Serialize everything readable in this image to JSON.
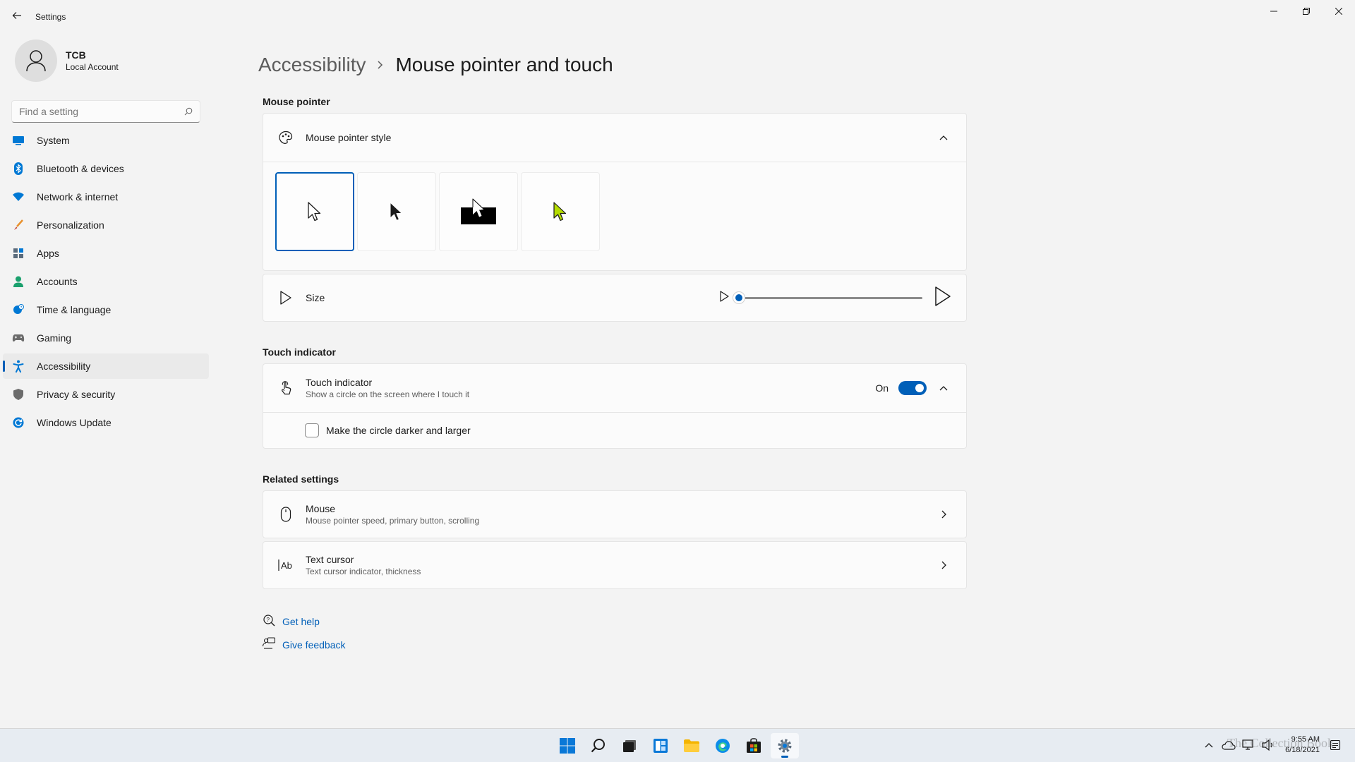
{
  "window": {
    "title": "Settings"
  },
  "profile": {
    "name": "TCB",
    "account_type": "Local Account"
  },
  "search": {
    "placeholder": "Find a setting"
  },
  "nav": {
    "items": [
      {
        "label": "System",
        "icon": "system-icon",
        "color": "#0078d4"
      },
      {
        "label": "Bluetooth & devices",
        "icon": "bluetooth-icon",
        "color": "#0078d4"
      },
      {
        "label": "Network & internet",
        "icon": "wifi-icon",
        "color": "#0078d4"
      },
      {
        "label": "Personalization",
        "icon": "brush-icon",
        "color": "#e8912d"
      },
      {
        "label": "Apps",
        "icon": "apps-icon",
        "color": "#5a6b7c"
      },
      {
        "label": "Accounts",
        "icon": "person-icon",
        "color": "#1aa06d"
      },
      {
        "label": "Time & language",
        "icon": "globe-clock-icon",
        "color": "#0078d4"
      },
      {
        "label": "Gaming",
        "icon": "gamepad-icon",
        "color": "#6b6b6b"
      },
      {
        "label": "Accessibility",
        "icon": "accessibility-icon",
        "color": "#0078d4",
        "active": true
      },
      {
        "label": "Privacy & security",
        "icon": "shield-icon",
        "color": "#6b6b6b"
      },
      {
        "label": "Windows Update",
        "icon": "update-icon",
        "color": "#0078d4"
      }
    ]
  },
  "breadcrumb": {
    "parent": "Accessibility",
    "current": "Mouse pointer and touch"
  },
  "mouse_pointer": {
    "section_title": "Mouse pointer",
    "style_label": "Mouse pointer style",
    "style_options": [
      "white",
      "black",
      "inverted",
      "custom"
    ],
    "selected_style": "white",
    "custom_color": "#b4dc00",
    "size_label": "Size",
    "size_value": 0.0
  },
  "touch": {
    "section_title": "Touch indicator",
    "title": "Touch indicator",
    "description": "Show a circle on the screen where I touch it",
    "state_label": "On",
    "enabled": true,
    "darker_label": "Make the circle darker and larger",
    "darker_checked": false
  },
  "related": {
    "section_title": "Related settings",
    "items": [
      {
        "title": "Mouse",
        "description": "Mouse pointer speed, primary button, scrolling",
        "icon": "mouse-icon"
      },
      {
        "title": "Text cursor",
        "description": "Text cursor indicator, thickness",
        "icon": "text-cursor-icon"
      }
    ]
  },
  "help": {
    "get_help": "Get help",
    "give_feedback": "Give feedback"
  },
  "taskbar": {
    "clock_time": "9:55 AM",
    "clock_date": "6/18/2021",
    "watermark": "The Collection Book"
  },
  "colors": {
    "accent": "#005fb8",
    "background": "#f3f3f3",
    "card": "#fbfbfb"
  }
}
